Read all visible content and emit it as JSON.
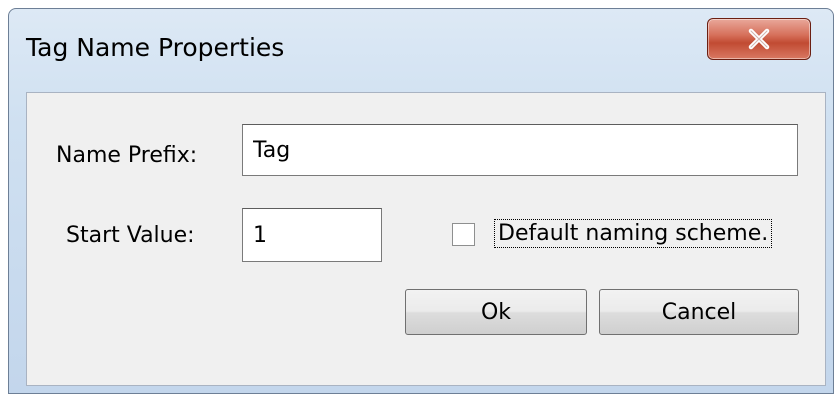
{
  "window": {
    "title": "Tag Name Properties"
  },
  "name_prefix": {
    "label": "Name Prefix:",
    "value": "Tag"
  },
  "start_value": {
    "label": "Start Value:",
    "value": "1"
  },
  "default_naming": {
    "label": "Default naming scheme.",
    "checked": false
  },
  "buttons": {
    "ok": "Ok",
    "cancel": "Cancel"
  },
  "colors": {
    "close_button": "#c94f38",
    "client_bg": "#f0f0f0"
  }
}
